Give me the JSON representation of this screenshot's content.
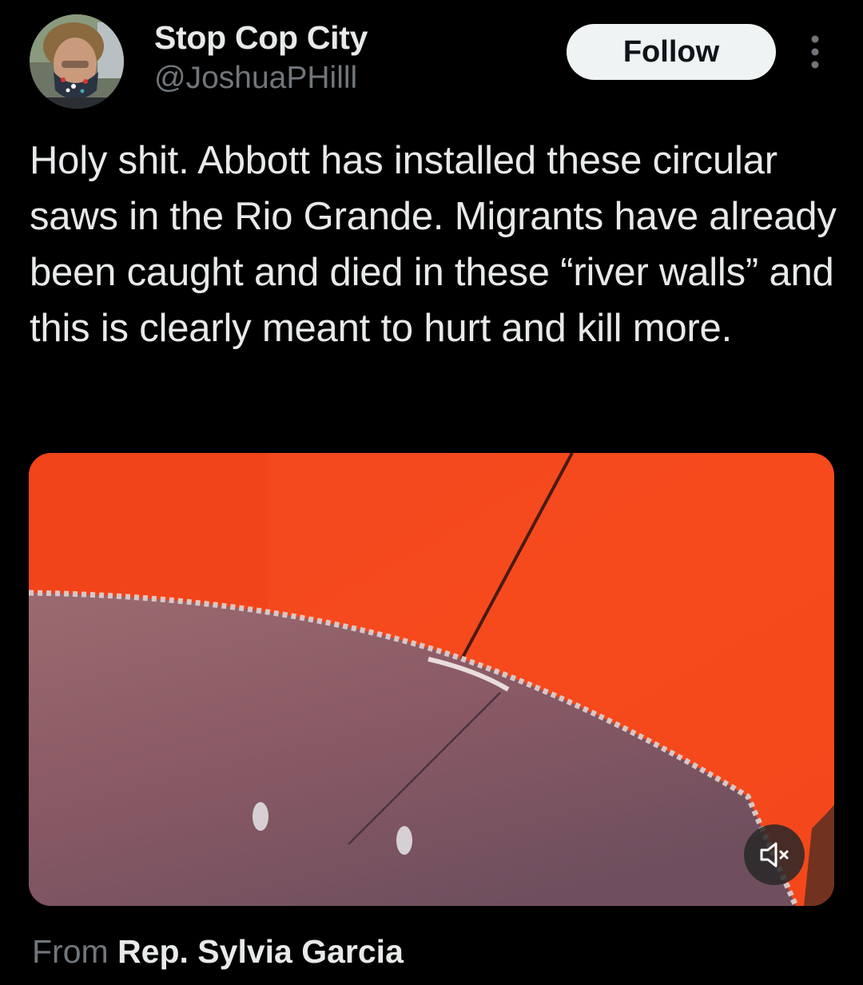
{
  "author": {
    "display_name": "Stop Cop City",
    "handle": "@JoshuaPHilll",
    "avatar_icon": "profile-photo"
  },
  "follow_label": "Follow",
  "more_icon": "more-vertical-icon",
  "tweet": {
    "text": "Holy shit. Abbott has installed these circular saws in the Rio Grande. Migrants have already been caught and died in these “river walls” and this is clearly meant to hurt and kill more."
  },
  "media": {
    "type": "video",
    "mute_icon": "volume-muted-icon"
  },
  "source": {
    "prefix": "From",
    "name": "Rep. Sylvia Garcia"
  },
  "colors": {
    "background": "#000000",
    "primary_text": "#e7e9ea",
    "secondary_text": "#71767b",
    "follow_bg": "#eff3f4"
  }
}
